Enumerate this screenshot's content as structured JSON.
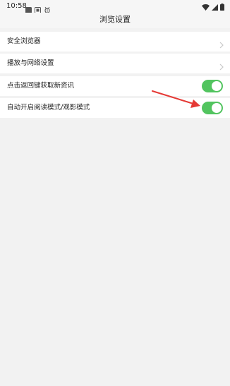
{
  "status_bar": {
    "time": "10:58",
    "icons": [
      "square-icon",
      "photo-icon",
      "bug-icon"
    ],
    "right_icons": [
      "wifi-icon",
      "signal-icon",
      "battery-icon"
    ]
  },
  "header": {
    "title": "浏览设置"
  },
  "settings": {
    "items": [
      {
        "label": "安全浏览器",
        "control": "chevron-right-icon"
      },
      {
        "label": "播放与网络设置",
        "control": "chevron-right-icon"
      },
      {
        "label": "点击返回键获取新资讯",
        "control": "toggle",
        "enabled": true
      },
      {
        "label": "自动开启阅读模式/观影模式",
        "control": "toggle",
        "enabled": true
      }
    ]
  },
  "annotation": {
    "arrow_color": "#e53935"
  },
  "colors": {
    "toggle_on": "#52c45f",
    "background": "#f2f2f2",
    "row_background": "#ffffff"
  }
}
